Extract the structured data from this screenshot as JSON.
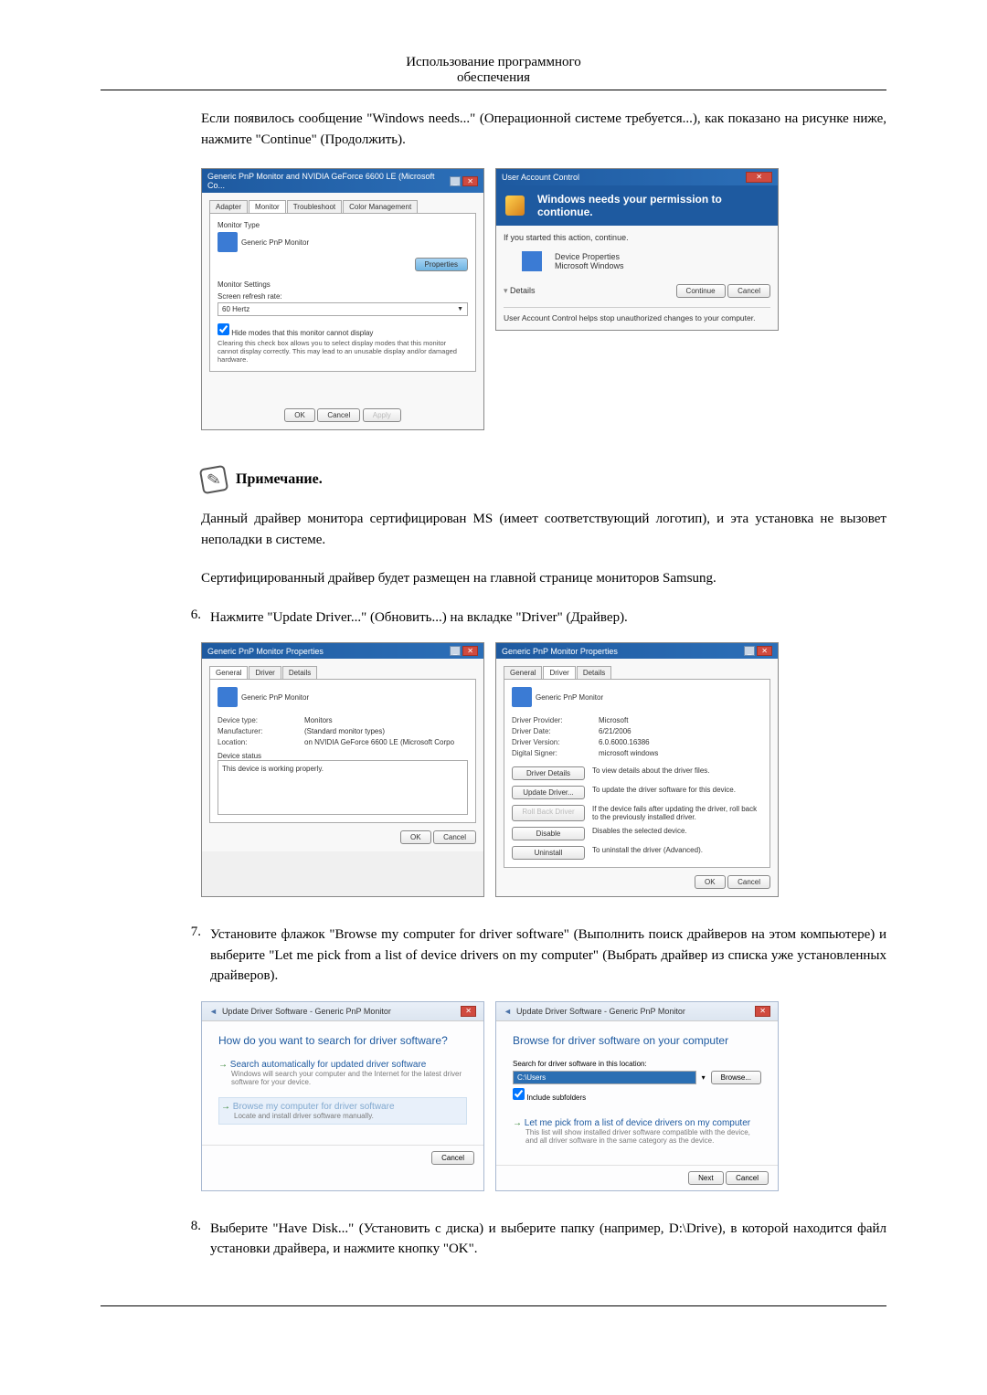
{
  "header": {
    "line1": "Использование программного",
    "line2": "обеспечения"
  },
  "intro": "Если появилось сообщение \"Windows needs...\" (Операционной системе требуется...), как показано на рисунке ниже, нажмите \"Continue\" (Продолжить).",
  "win1": {
    "title": "Generic PnP Monitor and NVIDIA GeForce 6600 LE (Microsoft Co...",
    "tabs": [
      "Adapter",
      "Monitor",
      "Troubleshoot",
      "Color Management"
    ],
    "mon_type": "Monitor Type",
    "mon_name": "Generic PnP Monitor",
    "properties": "Properties",
    "mon_settings": "Monitor Settings",
    "refresh_label": "Screen refresh rate:",
    "refresh_value": "60 Hertz",
    "checkbox": "Hide modes that this monitor cannot display",
    "note": "Clearing this check box allows you to select display modes that this monitor cannot display correctly. This may lead to an unusable display and/or damaged hardware.",
    "ok": "OK",
    "cancel": "Cancel",
    "apply": "Apply"
  },
  "uac": {
    "title": "User Account Control",
    "heading": "Windows needs your permission to contionue.",
    "ifstarted": "If you started this action, continue.",
    "item_title": "Device Properties",
    "item_pub": "Microsoft Windows",
    "details": "Details",
    "continue": "Continue",
    "cancel": "Cancel",
    "helps": "User Account Control helps stop unauthorized changes to your computer."
  },
  "note_section": {
    "heading": "Примечание.",
    "p1": "Данный драйвер монитора сертифицирован MS (имеет соответствующий логотип), и эта установка не вызовет неполадки в системе.",
    "p2": "Сертифицированный драйвер будет размещен на главной странице мониторов Samsung."
  },
  "step6": "Нажмите \"Update Driver...\" (Обновить...) на вкладке \"Driver\" (Драйвер).",
  "props_general": {
    "title": "Generic PnP Monitor Properties",
    "tabs": [
      "General",
      "Driver",
      "Details"
    ],
    "device": "Generic PnP Monitor",
    "type_k": "Device type:",
    "type_v": "Monitors",
    "manuf_k": "Manufacturer:",
    "manuf_v": "(Standard monitor types)",
    "loc_k": "Location:",
    "loc_v": "on NVIDIA GeForce 6600 LE (Microsoft Corpo",
    "status_label": "Device status",
    "status_text": "This device is working properly.",
    "ok": "OK",
    "cancel": "Cancel"
  },
  "props_driver": {
    "title": "Generic PnP Monitor Properties",
    "tabs": [
      "General",
      "Driver",
      "Details"
    ],
    "device": "Generic PnP Monitor",
    "provider_k": "Driver Provider:",
    "provider_v": "Microsoft",
    "date_k": "Driver Date:",
    "date_v": "6/21/2006",
    "version_k": "Driver Version:",
    "version_v": "6.0.6000.16386",
    "signer_k": "Digital Signer:",
    "signer_v": "microsoft windows",
    "btn_details": "Driver Details",
    "desc_details": "To view details about the driver files.",
    "btn_update": "Update Driver...",
    "desc_update": "To update the driver software for this device.",
    "btn_rollback": "Roll Back Driver",
    "desc_rollback": "If the device fails after updating the driver, roll back to the previously installed driver.",
    "btn_disable": "Disable",
    "desc_disable": "Disables the selected device.",
    "btn_uninstall": "Uninstall",
    "desc_uninstall": "To uninstall the driver (Advanced).",
    "ok": "OK",
    "cancel": "Cancel"
  },
  "step7": "Установите флажок \"Browse my computer for driver software\" (Выполнить поиск драйверов на этом компьютере) и выберите \"Let me pick from a list of device drivers on my computer\" (Выбрать драйвер из списка уже установленных драйверов).",
  "wiz1": {
    "crumb": "Update Driver Software - Generic PnP Monitor",
    "heading": "How do you want to search for driver software?",
    "opt1_title": "Search automatically for updated driver software",
    "opt1_desc": "Windows will search your computer and the Internet for the latest driver software for your device.",
    "opt2_title": "Browse my computer for driver software",
    "opt2_desc": "Locate and install driver software manually.",
    "cancel": "Cancel"
  },
  "wiz2": {
    "crumb": "Update Driver Software - Generic PnP Monitor",
    "heading": "Browse for driver software on your computer",
    "search_label": "Search for driver software in this location:",
    "path": "C:\\Users",
    "browse": "Browse...",
    "include": "Include subfolders",
    "opt_title": "Let me pick from a list of device drivers on my computer",
    "opt_desc": "This list will show installed driver software compatible with the device, and all driver software in the same category as the device.",
    "next": "Next",
    "cancel": "Cancel"
  },
  "step8": "Выберите \"Have Disk...\" (Установить с диска) и выберите папку (например, D:\\Drive), в которой находится файл установки драйвера, и нажмите кнопку \"OK\".",
  "nums": {
    "n6": "6.",
    "n7": "7.",
    "n8": "8."
  }
}
